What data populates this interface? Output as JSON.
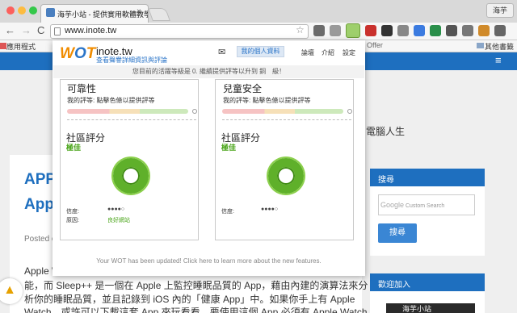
{
  "browser": {
    "tab_title": "海芋小站 - 提供實用軟體教學",
    "tab_close": "×",
    "profile_name": "海芋",
    "url": "www.inote.tw",
    "nav_back": "←",
    "nav_forward": "→",
    "nav_reload": "C",
    "star": "☆",
    "bookmarks": {
      "apps": "應用程式",
      "offer": "Offer",
      "other": "其他書籤"
    }
  },
  "site": {
    "menu": "≡",
    "tagline": "電腦人生",
    "article_title_1": "APP",
    "article_title_2": "App",
    "posted": "Posted o",
    "body_lines": [
      "Apple W",
      "能，而 Sleep++ 是一個在 Apple 上監控睡眠品質的 App，藉由內建的演算法來分",
      "析你的睡眠品質，並且記錄到 iOS 內的「健康 App」中。如果你手上有 Apple",
      "Watch，或許可以下載這套 App 來玩看看。要使用這個 App 必須有 Apple Watch，"
    ],
    "search_widget": {
      "heading": "搜尋",
      "placeholder": "Custom Search",
      "google": "Google",
      "button": "搜尋"
    },
    "join_widget": {
      "heading": "歡迎加入",
      "logo_text": "海芋小站"
    }
  },
  "wot": {
    "logo_w": "W",
    "logo_o": "O",
    "logo_t": "T",
    "domain": "inote.tw",
    "details_link": "查看聲譽詳細資訊與評論",
    "mail": "✉",
    "profile_button": "我的個人資料",
    "nav": [
      "論壇",
      "介紹",
      "設定"
    ],
    "status": "您目前的活躍等級是 0. 繼續提供評等以升到 銅　級！",
    "panels": [
      {
        "title": "可靠性",
        "my_rating": "我的評等: 點擊色條以提供評等",
        "community": "社區評分",
        "grade": "極佳",
        "confidence_label": "信度:",
        "confidence": "●●●●○",
        "reason_label": "原因:",
        "reason": "良好網站"
      },
      {
        "title": "兒童安全",
        "my_rating": "我的評等: 點擊色條以提供評等",
        "community": "社區評分",
        "grade": "極佳",
        "confidence_label": "信度:",
        "confidence": "●●●●○",
        "reason_label": "",
        "reason": ""
      }
    ],
    "footer": "Your WOT has been updated! Click here to learn more about the new features."
  }
}
